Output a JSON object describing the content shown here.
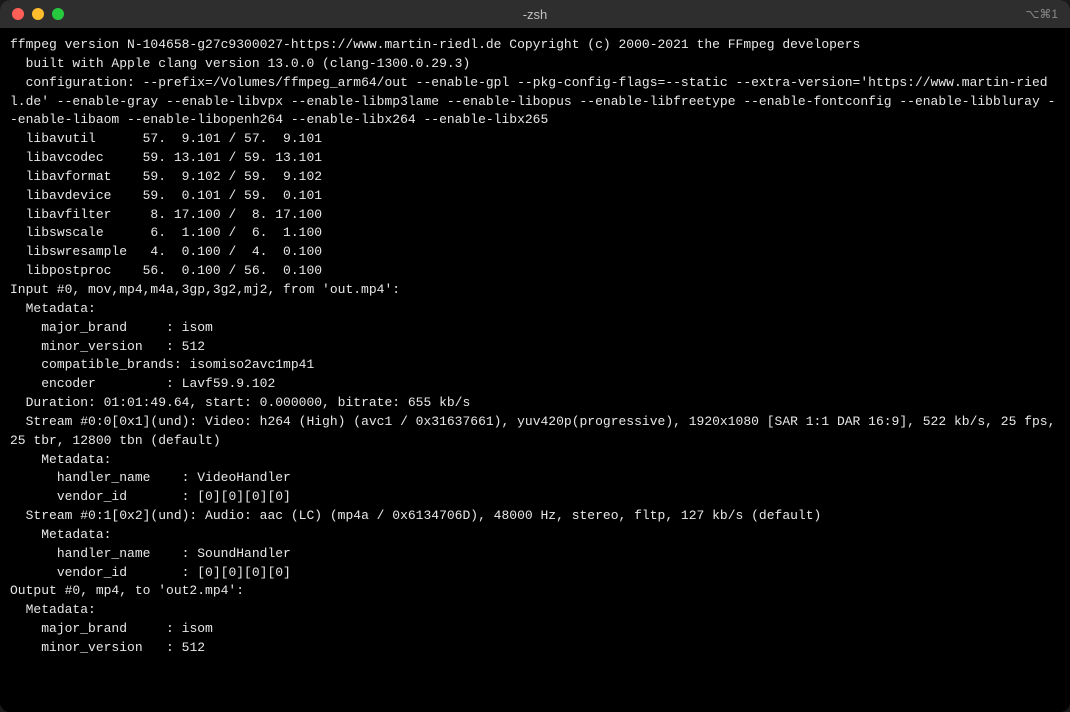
{
  "window": {
    "title": "-zsh",
    "shortcut": "⌥⌘1"
  },
  "terminal": {
    "lines": [
      "ffmpeg version N-104658-g27c9300027-https://www.martin-riedl.de Copyright (c) 2000-2021 the FFmpeg developers",
      "  built with Apple clang version 13.0.0 (clang-1300.0.29.3)",
      "  configuration: --prefix=/Volumes/ffmpeg_arm64/out --enable-gpl --pkg-config-flags=--static --extra-version='https://www.martin-riedl.de' --enable-gray --enable-libvpx --enable-libmp3lame --enable-libopus --enable-libfreetype --enable-fontconfig --enable-libbluray --enable-libaom --enable-libopenh264 --enable-libx264 --enable-libx265",
      "  libavutil      57.  9.101 / 57.  9.101",
      "  libavcodec     59. 13.101 / 59. 13.101",
      "  libavformat    59.  9.102 / 59.  9.102",
      "  libavdevice    59.  0.101 / 59.  0.101",
      "  libavfilter     8. 17.100 /  8. 17.100",
      "  libswscale      6.  1.100 /  6.  1.100",
      "  libswresample   4.  0.100 /  4.  0.100",
      "  libpostproc    56.  0.100 / 56.  0.100",
      "Input #0, mov,mp4,m4a,3gp,3g2,mj2, from 'out.mp4':",
      "  Metadata:",
      "    major_brand     : isom",
      "    minor_version   : 512",
      "    compatible_brands: isomiso2avc1mp41",
      "    encoder         : Lavf59.9.102",
      "  Duration: 01:01:49.64, start: 0.000000, bitrate: 655 kb/s",
      "  Stream #0:0[0x1](und): Video: h264 (High) (avc1 / 0x31637661), yuv420p(progressive), 1920x1080 [SAR 1:1 DAR 16:9], 522 kb/s, 25 fps, 25 tbr, 12800 tbn (default)",
      "    Metadata:",
      "      handler_name    : VideoHandler",
      "      vendor_id       : [0][0][0][0]",
      "  Stream #0:1[0x2](und): Audio: aac (LC) (mp4a / 0x6134706D), 48000 Hz, stereo, fltp, 127 kb/s (default)",
      "    Metadata:",
      "      handler_name    : SoundHandler",
      "      vendor_id       : [0][0][0][0]",
      "Output #0, mp4, to 'out2.mp4':",
      "  Metadata:",
      "    major_brand     : isom",
      "    minor_version   : 512"
    ]
  }
}
